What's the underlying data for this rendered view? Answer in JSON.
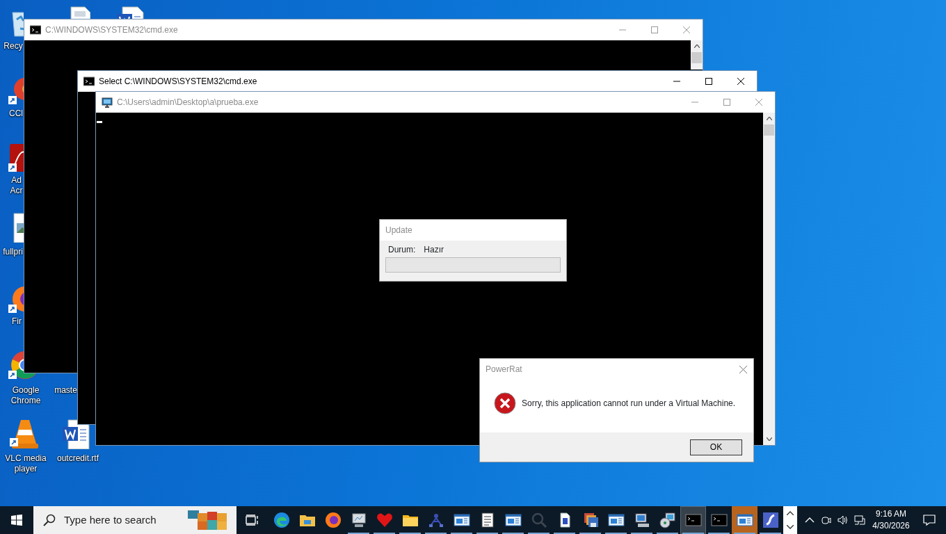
{
  "desktop_icons": [
    {
      "kind": "recycle_bin",
      "label": "Recy"
    },
    {
      "kind": "document"
    },
    {
      "kind": "word_document"
    },
    {
      "kind": "ccleaner",
      "label": "CCl"
    },
    {
      "kind": "pdf_reader",
      "label": "Ad Acr"
    },
    {
      "kind": "image_file",
      "label": "fullpri"
    },
    {
      "kind": "firefox",
      "label": "Fir"
    },
    {
      "kind": "chrome",
      "label": "Google Chrome"
    },
    {
      "kind": "file",
      "label": "maste"
    },
    {
      "kind": "vlc",
      "label": "VLC media player"
    },
    {
      "kind": "word_document",
      "label": "outcredit.rtf"
    }
  ],
  "windows": [
    {
      "title": "C:\\WINDOWS\\SYSTEM32\\cmd.exe",
      "kind": "console",
      "active": false,
      "cursor": false
    },
    {
      "title": "Select C:\\WINDOWS\\SYSTEM32\\cmd.exe",
      "kind": "console",
      "active": true,
      "cursor": false
    },
    {
      "title": "C:\\Users\\admin\\Desktop\\a\\prueba.exe",
      "kind": "app_console",
      "active": false,
      "cursor": true
    }
  ],
  "update_dialog": {
    "title": "Update",
    "status_label": "Durum:",
    "status_value": "Hazır",
    "progress": {
      "level": 0
    }
  },
  "message_box": {
    "title": "PowerRat",
    "message": "Sorry, this application cannot run under a Virtual Machine.",
    "button": "OK"
  },
  "taskbar": {
    "search": {
      "placeholder": "Type here to search"
    },
    "apps": [
      {
        "kind": "edge",
        "running": false,
        "selected": false,
        "flashing": false
      },
      {
        "kind": "explorer",
        "running": false,
        "selected": false,
        "flashing": false
      },
      {
        "kind": "firefox",
        "running": false,
        "selected": false,
        "flashing": false
      },
      {
        "kind": "monitor",
        "running": true,
        "selected": false,
        "flashing": false
      },
      {
        "kind": "heart",
        "running": true,
        "selected": false,
        "flashing": false
      },
      {
        "kind": "folder",
        "running": true,
        "selected": false,
        "flashing": false
      },
      {
        "kind": "network",
        "running": true,
        "selected": false,
        "flashing": false
      },
      {
        "kind": "window",
        "running": true,
        "selected": false,
        "flashing": false
      },
      {
        "kind": "notepad",
        "running": true,
        "selected": false,
        "flashing": false
      },
      {
        "kind": "window",
        "running": true,
        "selected": false,
        "flashing": false
      },
      {
        "kind": "magnifier",
        "running": true,
        "selected": false,
        "flashing": false
      },
      {
        "kind": "document",
        "running": true,
        "selected": false,
        "flashing": false
      },
      {
        "kind": "floppy",
        "running": true,
        "selected": false,
        "flashing": false
      },
      {
        "kind": "window",
        "running": true,
        "selected": false,
        "flashing": false
      },
      {
        "kind": "computer",
        "running": true,
        "selected": false,
        "flashing": false
      },
      {
        "kind": "disc",
        "running": true,
        "selected": false,
        "flashing": false
      },
      {
        "kind": "console",
        "running": true,
        "selected": true,
        "flashing": false
      },
      {
        "kind": "console",
        "running": true,
        "selected": false,
        "flashing": false
      },
      {
        "kind": "window",
        "running": true,
        "selected": false,
        "flashing": true
      },
      {
        "kind": "swirl",
        "running": true,
        "selected": false,
        "flashing": false
      }
    ],
    "clock": {
      "time": "9:16 AM",
      "date": "4/30/2026"
    }
  }
}
